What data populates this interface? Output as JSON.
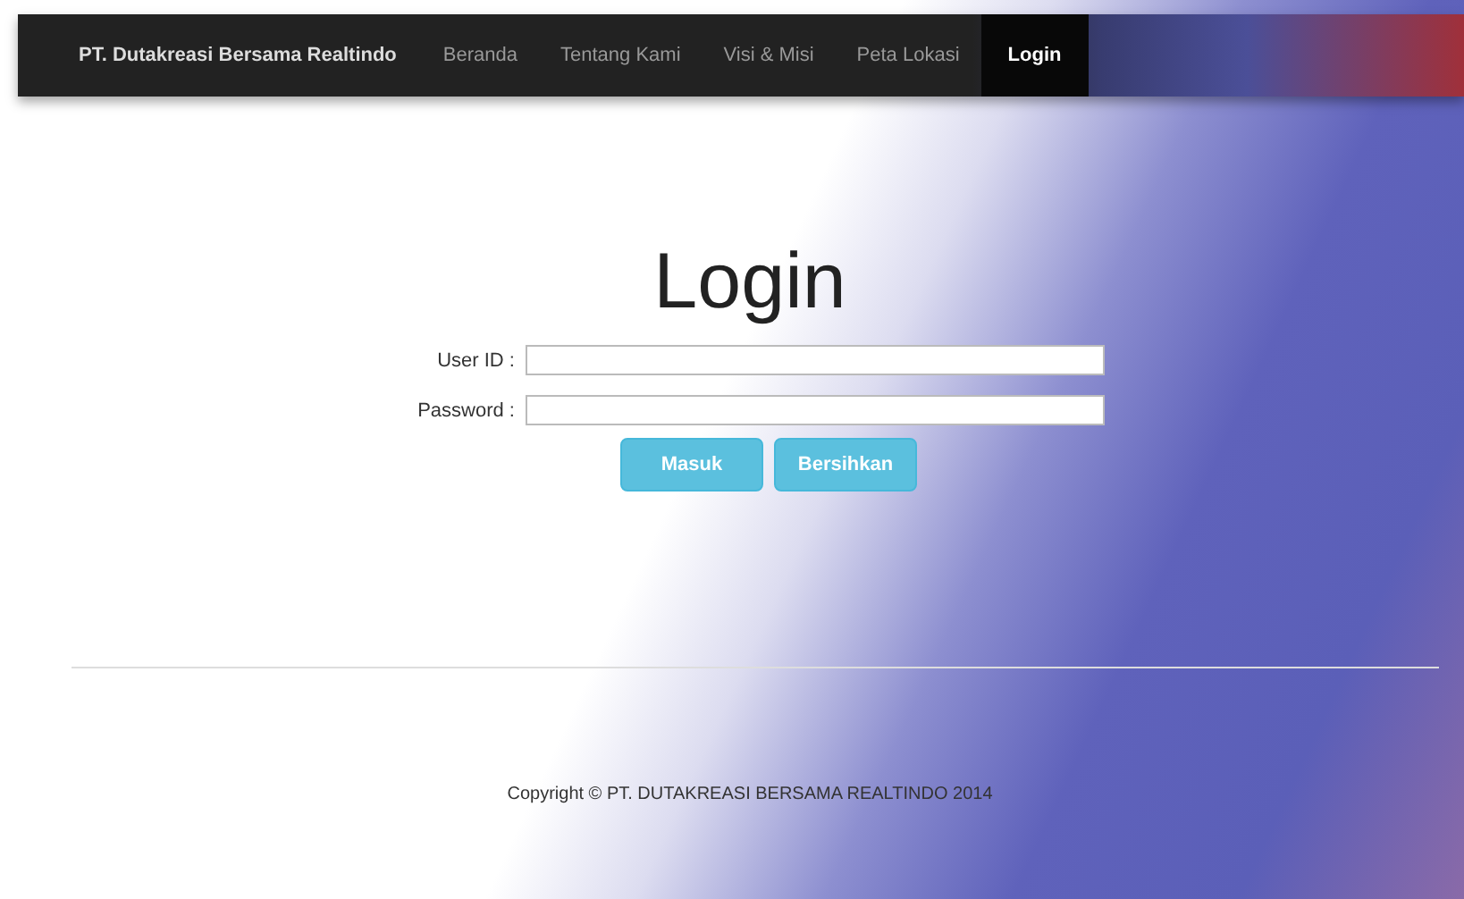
{
  "navbar": {
    "brand": "PT. Dutakreasi Bersama Realtindo",
    "items": [
      {
        "label": "Beranda",
        "selected": false
      },
      {
        "label": "Tentang Kami",
        "selected": false
      },
      {
        "label": "Visi & Misi",
        "selected": false
      },
      {
        "label": "Peta Lokasi",
        "selected": false
      },
      {
        "label": "Login",
        "selected": true
      }
    ]
  },
  "title": "Login",
  "fields": [
    {
      "label": "User ID :"
    },
    {
      "label": "Password :"
    }
  ],
  "buttons": [
    "Masuk",
    "Bersihkan"
  ],
  "footer": "Copyright © PT. DUTAKREASI BERSAMA REALTINDO 2014"
}
